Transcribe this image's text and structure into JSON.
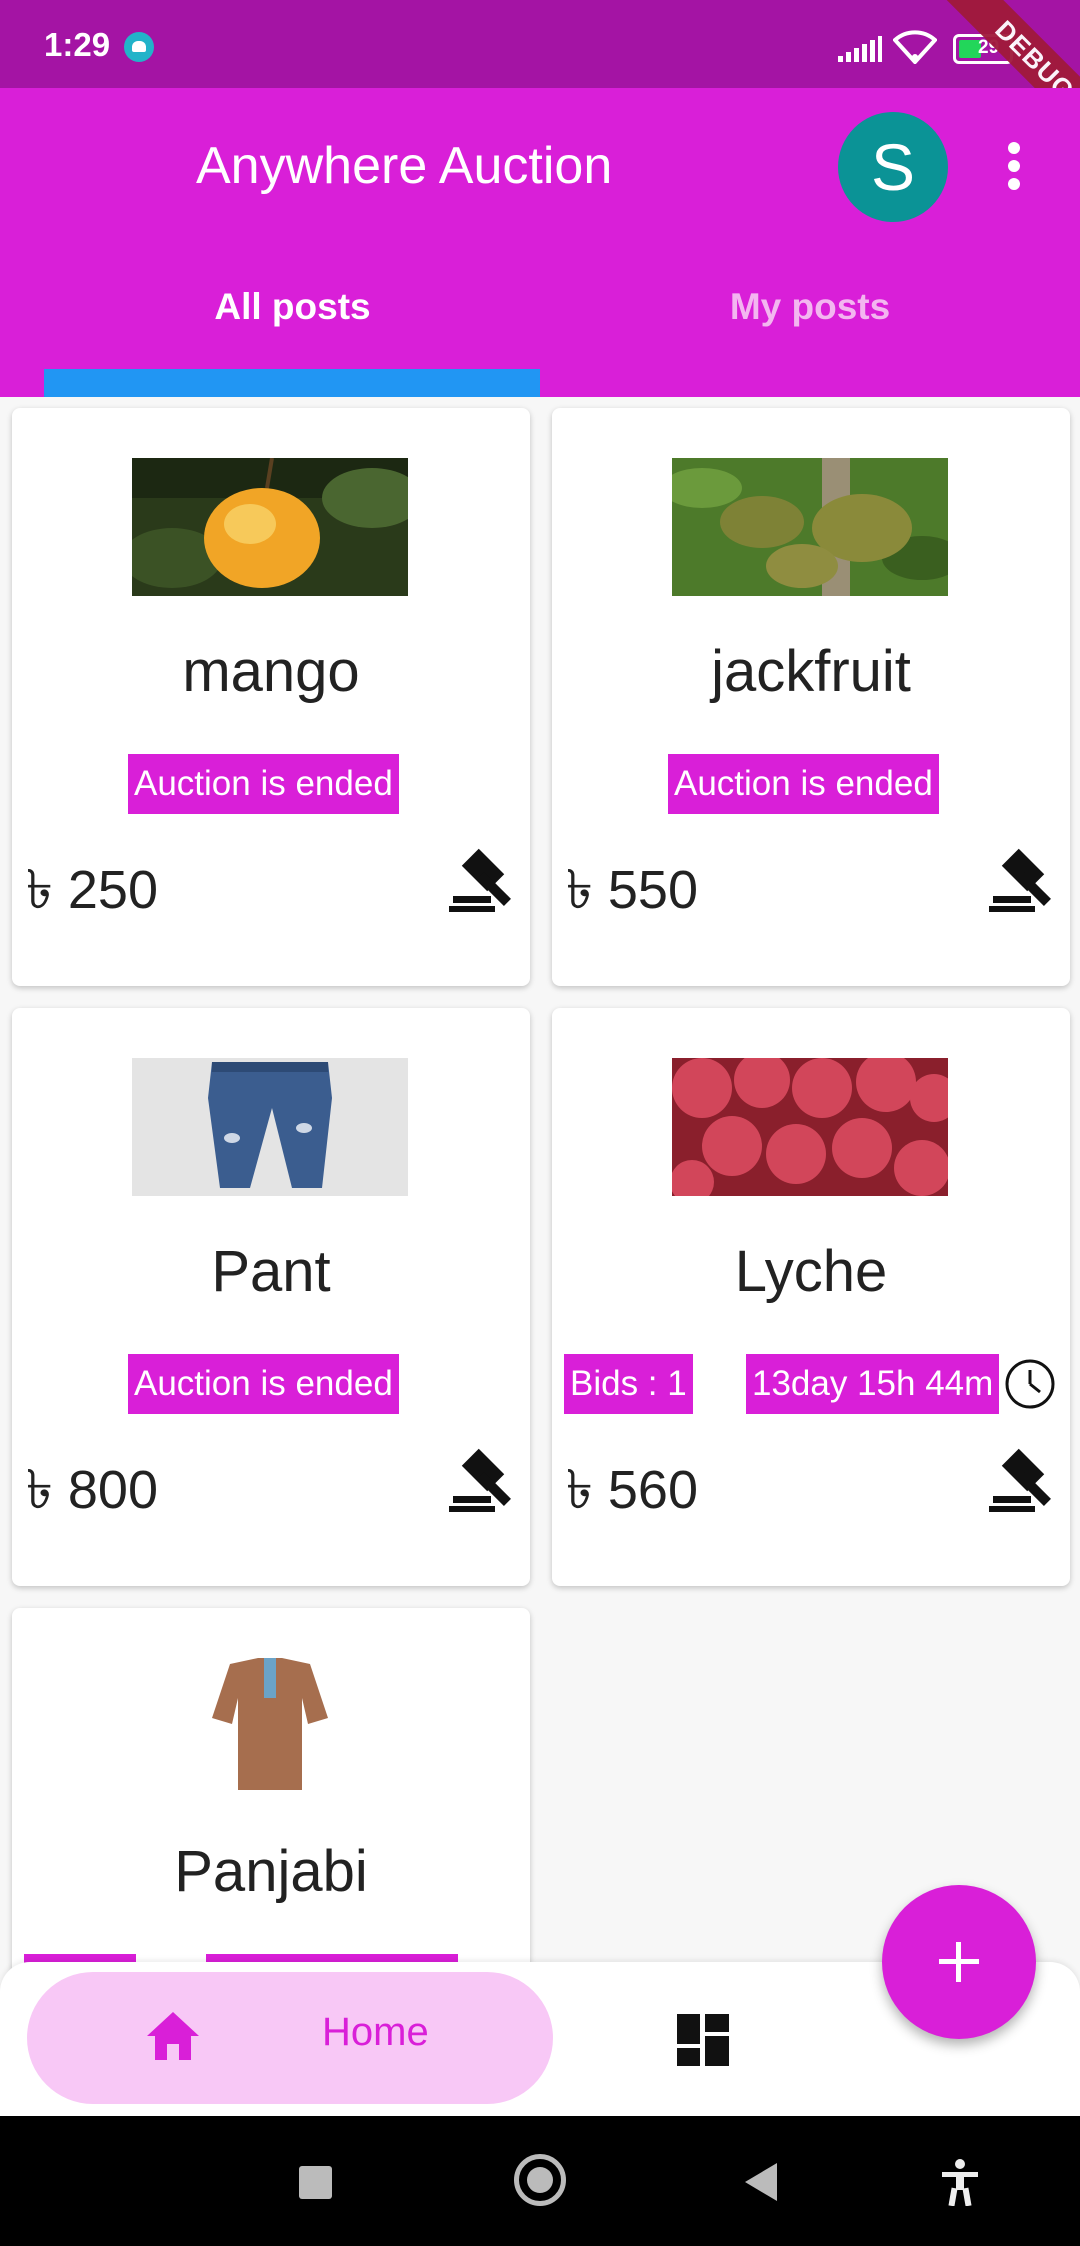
{
  "status_bar": {
    "time": "1:29",
    "battery": "29",
    "debug_banner": "DEBUG"
  },
  "app_bar": {
    "title": "Anywhere Auction",
    "avatar_letter": "S"
  },
  "tabs": [
    {
      "label": "All posts",
      "selected": true
    },
    {
      "label": "My posts",
      "selected": false
    }
  ],
  "posts": [
    {
      "name": "mango",
      "status": "Auction is ended",
      "price": "৳ 250",
      "image": "mango-photo"
    },
    {
      "name": "jackfruit",
      "status": "Auction is ended",
      "price": "৳ 550",
      "image": "jackfruit-photo"
    },
    {
      "name": "Pant",
      "status": "Auction is ended",
      "price": "৳ 800",
      "image": "jeans-photo"
    },
    {
      "name": "Lyche",
      "bids": "Bids : 1",
      "time_left": "13day 15h 44m",
      "price": "৳ 560",
      "image": "lychee-photo"
    },
    {
      "name": "Panjabi",
      "image": "panjabi-photo"
    }
  ],
  "bottom_nav": {
    "home_label": "Home"
  },
  "colors": {
    "primary": "#d91fd8",
    "status_bar": "#a414a4",
    "tab_indicator": "#2196f3",
    "avatar": "#0b9396"
  }
}
